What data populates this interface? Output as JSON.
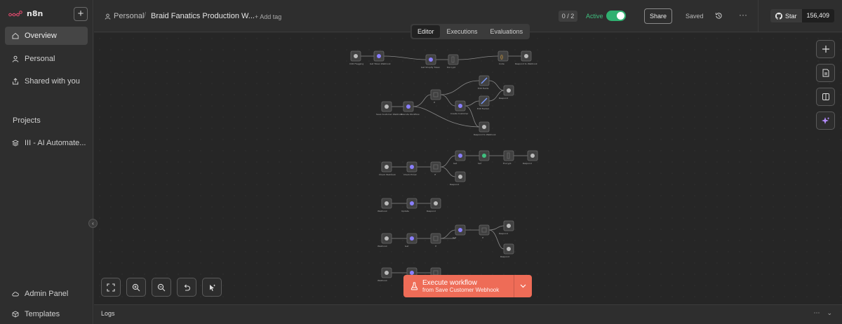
{
  "app": {
    "name": "n8n"
  },
  "sidebar": {
    "add_label": "+",
    "nav": [
      {
        "label": "Overview",
        "icon": "home-icon"
      },
      {
        "label": "Personal",
        "icon": "user-icon"
      },
      {
        "label": "Shared with you",
        "icon": "share-icon"
      }
    ],
    "projects_title": "Projects",
    "projects": [
      {
        "label": "III - AI Automate...",
        "icon": "layers-icon"
      }
    ],
    "footer": [
      {
        "label": "Admin Panel",
        "icon": "cloud-icon"
      },
      {
        "label": "Templates",
        "icon": "box-icon"
      }
    ],
    "collapse_glyph": "‹"
  },
  "header": {
    "breadcrumb_owner": "Personal",
    "breadcrumb_sep": "/",
    "workflow_name": "Braid Fanatics Production W...",
    "add_tag": "+ Add tag",
    "counter": "0 / 2",
    "active_label": "Active",
    "active": true,
    "share_label": "Share",
    "saved_label": "Saved",
    "more_glyph": "···",
    "github_star_label": "Star",
    "github_star_count": "156,409"
  },
  "tabs": [
    {
      "label": "Editor",
      "active": true
    },
    {
      "label": "Executions",
      "active": false
    },
    {
      "label": "Evaluations",
      "active": false
    }
  ],
  "canvas": {
    "right_tools": [
      "plus-icon",
      "sticky-note-icon",
      "panel-icon",
      "ai-sparkle-icon"
    ],
    "bottom_tools": [
      "fit-view-icon",
      "zoom-in-icon",
      "zoom-out-icon",
      "undo-icon",
      "tidy-up-icon"
    ]
  },
  "execute": {
    "label": "Execute workflow",
    "sublabel": "from Save Customer Webhook"
  },
  "logs": {
    "title": "Logs",
    "ctl_1": "⋯",
    "ctl_2": "⌄"
  },
  "colors": {
    "accent": "#ee6c57",
    "active_green": "#30b070",
    "canvas_bg": "#262626"
  }
}
